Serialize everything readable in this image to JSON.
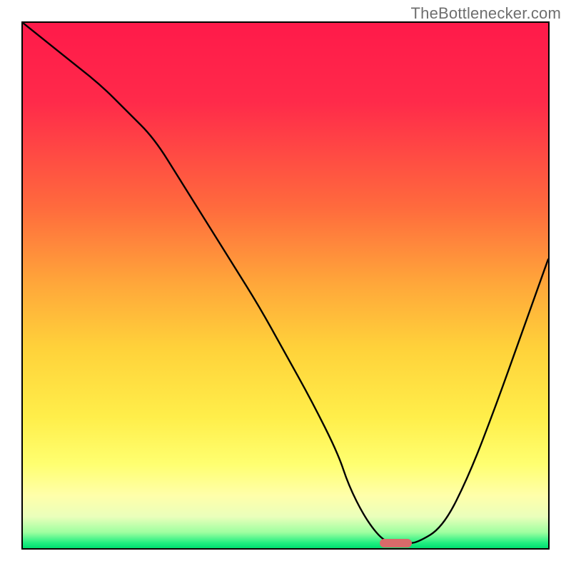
{
  "attribution": "TheBottlenecker.com",
  "chart_data": {
    "type": "line",
    "title": "",
    "xlabel": "",
    "ylabel": "",
    "xlim": [
      0,
      100
    ],
    "ylim": [
      0,
      100
    ],
    "x": [
      0,
      5,
      10,
      15,
      20,
      25,
      30,
      35,
      40,
      45,
      50,
      55,
      60,
      62,
      65,
      68,
      70,
      73,
      75,
      80,
      85,
      90,
      95,
      100
    ],
    "values": [
      100,
      96,
      92,
      88,
      83,
      78,
      70,
      62,
      54,
      46,
      37,
      28,
      18,
      12,
      6,
      2,
      1,
      1,
      1,
      4,
      14,
      27,
      41,
      55
    ],
    "minimum_marker": {
      "x_start": 68,
      "x_end": 74,
      "y": 1
    },
    "background_gradient": {
      "type": "vertical",
      "stops": [
        {
          "pos": 0.0,
          "color": "#ff1a4a"
        },
        {
          "pos": 0.35,
          "color": "#ff6a3d"
        },
        {
          "pos": 0.62,
          "color": "#ffd23a"
        },
        {
          "pos": 0.84,
          "color": "#ffff70"
        },
        {
          "pos": 0.97,
          "color": "#9effa0"
        },
        {
          "pos": 1.0,
          "color": "#00dd70"
        }
      ]
    }
  }
}
